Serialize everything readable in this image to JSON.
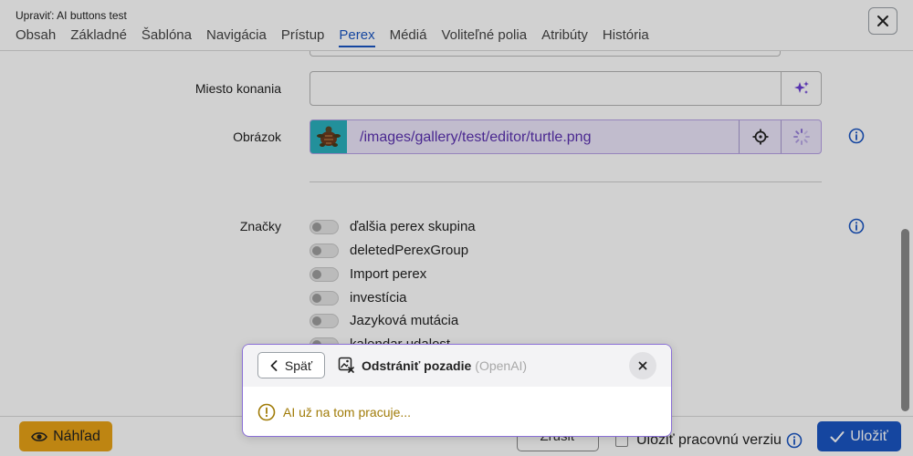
{
  "window": {
    "title": "Upraviť: AI buttons test"
  },
  "tabs": [
    {
      "label": "Obsah",
      "active": false
    },
    {
      "label": "Základné",
      "active": false
    },
    {
      "label": "Šablóna",
      "active": false
    },
    {
      "label": "Navigácia",
      "active": false
    },
    {
      "label": "Prístup",
      "active": false
    },
    {
      "label": "Perex",
      "active": true
    },
    {
      "label": "Médiá",
      "active": false
    },
    {
      "label": "Voliteľné polia",
      "active": false
    },
    {
      "label": "Atribúty",
      "active": false
    },
    {
      "label": "História",
      "active": false
    }
  ],
  "form": {
    "location_label": "Miesto konania",
    "location_value": "",
    "image_label": "Obrázok",
    "image_path": "/images/gallery/test/editor/turtle.png",
    "tags_label": "Značky",
    "tags": [
      "ďalšia perex skupina",
      "deletedPerexGroup",
      "Import perex",
      "investícia",
      "Jazyková mutácia",
      "kalendar udalost"
    ]
  },
  "footer": {
    "preview_label": "Náhľad",
    "cancel_label": "Zrušiť",
    "draft_label": "Uložiť pracovnú verziu",
    "save_label": "Uložiť"
  },
  "dialog": {
    "back_label": "Späť",
    "title": "Odstrániť pozadie",
    "provider": "(OpenAI)",
    "status": "AI už na tom pracuje..."
  },
  "colors": {
    "accent": "#1a56c4",
    "ai_purple": "#6b3fd6",
    "preview_yellow": "#e8a317",
    "warning": "#a07b07"
  }
}
